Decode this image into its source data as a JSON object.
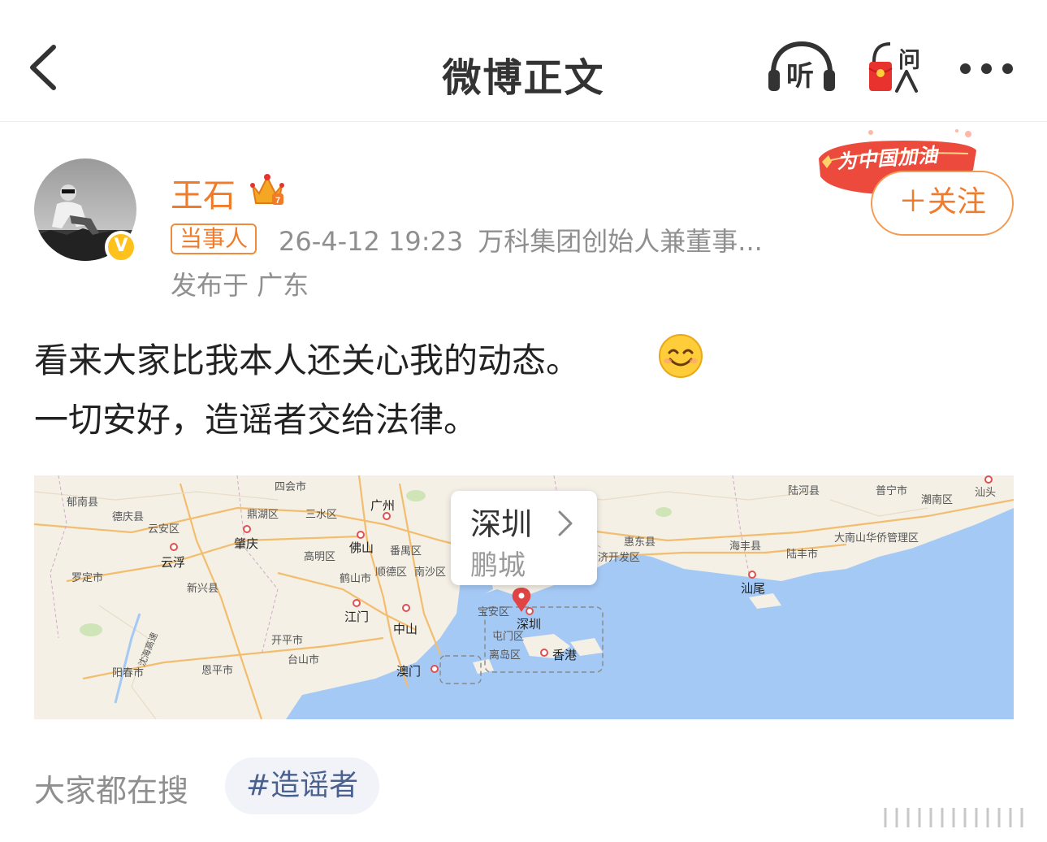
{
  "header": {
    "title": "微博正文",
    "listen_label": "听",
    "ask_label": "问"
  },
  "author": {
    "name": "王石",
    "role_tag": "当事人",
    "timestamp": "26-4-12 19:23",
    "description": "万科集团创始人兼董事...",
    "location": "发布于 广东",
    "verified_badge": "V"
  },
  "campaign": {
    "text": "为中国加油"
  },
  "follow": {
    "label": "＋关注"
  },
  "post": {
    "line1": "看来大家比我本人还关心我的动态。",
    "line2": "一切安好，造谣者交给法律。",
    "emoji": "smile-emoji"
  },
  "map": {
    "card_title": "深圳",
    "card_subtitle": "鹏城",
    "labels": [
      {
        "key": "sihui",
        "text": "四会市"
      },
      {
        "key": "guangzhou",
        "text": "广州"
      },
      {
        "key": "luhe",
        "text": "陆河县"
      },
      {
        "key": "puning",
        "text": "普宁市"
      },
      {
        "key": "chaonan",
        "text": "潮南区"
      },
      {
        "key": "shantou",
        "text": "汕头"
      },
      {
        "key": "yunan",
        "text": "郁南县"
      },
      {
        "key": "deqing",
        "text": "德庆县"
      },
      {
        "key": "yunan2",
        "text": "云安区"
      },
      {
        "key": "dinghu",
        "text": "鼎湖区"
      },
      {
        "key": "sanshui",
        "text": "三水区"
      },
      {
        "key": "zhaoqing",
        "text": "肇庆"
      },
      {
        "key": "foshan",
        "text": "佛山"
      },
      {
        "key": "panyu",
        "text": "番禺区"
      },
      {
        "key": "huidong",
        "text": "惠东县"
      },
      {
        "key": "haifeng",
        "text": "海丰县"
      },
      {
        "key": "dananshan",
        "text": "大南山华侨管理区"
      },
      {
        "key": "yunfu",
        "text": "云浮"
      },
      {
        "key": "gaoming",
        "text": "高明区"
      },
      {
        "key": "shunde",
        "text": "顺德区"
      },
      {
        "key": "nansha",
        "text": "南沙区"
      },
      {
        "key": "kaifaqu",
        "text": "济开发区"
      },
      {
        "key": "lufeng",
        "text": "陆丰市"
      },
      {
        "key": "luoding",
        "text": "罗定市"
      },
      {
        "key": "xinxing",
        "text": "新兴县"
      },
      {
        "key": "heshan",
        "text": "鹤山市"
      },
      {
        "key": "shanwei",
        "text": "汕尾"
      },
      {
        "key": "baoan",
        "text": "宝安区"
      },
      {
        "key": "jiangmen",
        "text": "江门"
      },
      {
        "key": "zhongshan",
        "text": "中山"
      },
      {
        "key": "shenzhen",
        "text": "深圳"
      },
      {
        "key": "kaiping",
        "text": "开平市"
      },
      {
        "key": "tunmen",
        "text": "屯门区"
      },
      {
        "key": "lidao",
        "text": "离岛区"
      },
      {
        "key": "hongkong",
        "text": "香港"
      },
      {
        "key": "taishan",
        "text": "台山市"
      },
      {
        "key": "yangchun",
        "text": "阳春市"
      },
      {
        "key": "enping",
        "text": "恩平市"
      },
      {
        "key": "macau",
        "text": "澳门"
      },
      {
        "key": "expressway",
        "text": "沈海高速"
      }
    ]
  },
  "bottom": {
    "search_label": "大家都在搜",
    "hashtag": "#造谣者"
  },
  "colors": {
    "orange": "#f07b2a",
    "map_sea": "#a5c9f5",
    "map_land": "#f5f1e8"
  }
}
